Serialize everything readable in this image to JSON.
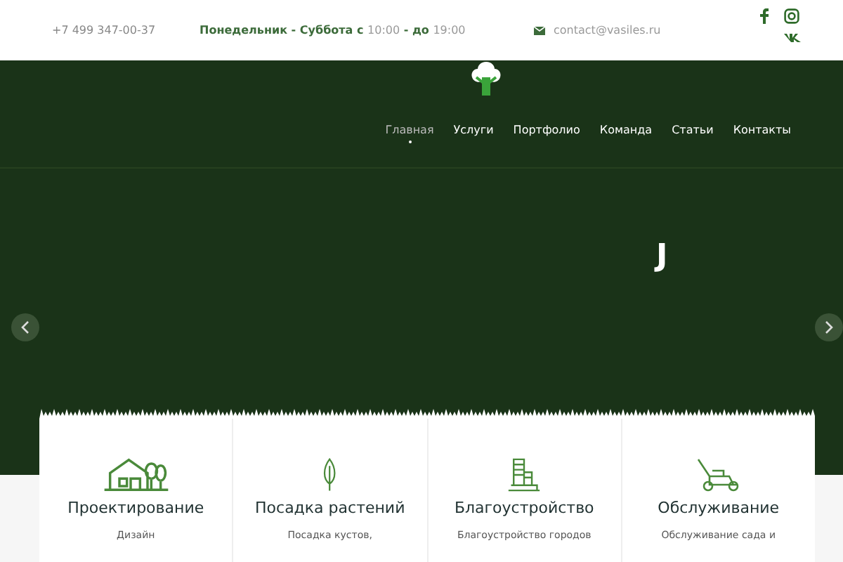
{
  "topbar": {
    "phone": "+7 499 347-00-37",
    "schedule": [
      {
        "text": "Понедельник - Суббота с ",
        "kind": "label"
      },
      {
        "text": "10:00",
        "kind": "time"
      },
      {
        "text": " - до ",
        "kind": "label"
      },
      {
        "text": "19:00",
        "kind": "time"
      }
    ],
    "email": "contact@vasiles.ru"
  },
  "nav": [
    {
      "label": "Главная",
      "selected": true
    },
    {
      "label": "Услуги",
      "selected": false
    },
    {
      "label": "Портфолио",
      "selected": false
    },
    {
      "label": "Команда",
      "selected": false
    },
    {
      "label": "Статьи",
      "selected": false
    },
    {
      "label": "Контакты",
      "selected": false
    }
  ],
  "slide_text": "J",
  "services": [
    {
      "kind": "house",
      "title": "Проектирование",
      "text": "Дизайн"
    },
    {
      "kind": "tree",
      "title": "Посадка растений",
      "text": "Посадка кустов,"
    },
    {
      "kind": "buildings",
      "title": "Благоустройство",
      "text": "Благоустройство городов"
    },
    {
      "kind": "mower",
      "title": "Обслуживание",
      "text": "Обслуживание сада и"
    }
  ]
}
